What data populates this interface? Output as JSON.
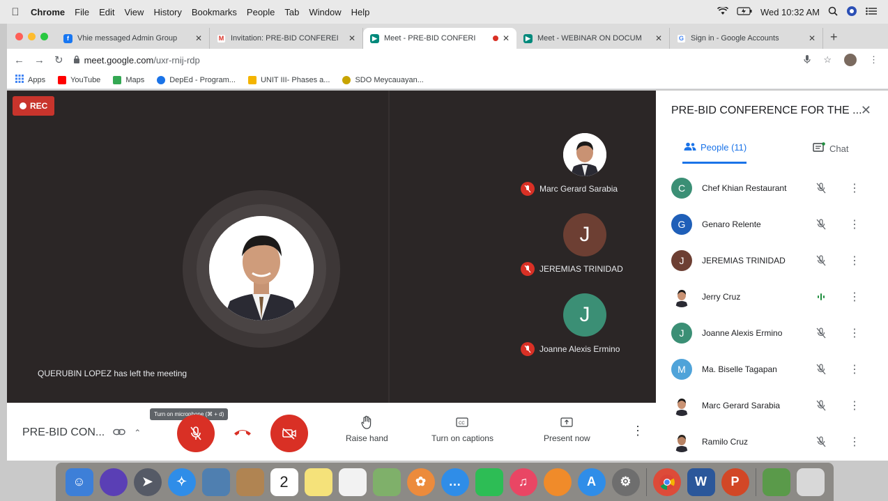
{
  "menubar": {
    "app": "Chrome",
    "items": [
      "File",
      "Edit",
      "View",
      "History",
      "Bookmarks",
      "People",
      "Tab",
      "Window",
      "Help"
    ],
    "clock": "Wed 10:32 AM"
  },
  "tabs": [
    {
      "title": "Vhie messaged Admin Group",
      "favicon_color": "#1877f2"
    },
    {
      "title": "Invitation: PRE-BID CONFEREI",
      "favicon_color": "#d93025"
    },
    {
      "title": "Meet - PRE-BID CONFERI",
      "favicon_color": "#00897b"
    },
    {
      "title": "Meet - WEBINAR ON DOCUM",
      "favicon_color": "#00897b"
    },
    {
      "title": "Sign in - Google Accounts",
      "favicon_color": "#4285f4"
    }
  ],
  "address": {
    "host": "meet.google.com",
    "path": "/uxr-rnij-rdp"
  },
  "bookmarks": [
    {
      "label": "Apps",
      "color": "#4285f4"
    },
    {
      "label": "YouTube",
      "color": "#ff0000"
    },
    {
      "label": "Maps",
      "color": "#34a853"
    },
    {
      "label": "DepEd - Program...",
      "color": "#1a73e8"
    },
    {
      "label": "UNIT III- Phases a...",
      "color": "#f4b400"
    },
    {
      "label": "SDO Meycauayan...",
      "color": "#c8a400"
    }
  ],
  "stage": {
    "rec_label": "REC",
    "toast": "QUERUBIN LOPEZ has left the meeting",
    "tiles": [
      {
        "name": "Marc Gerard Sarabia",
        "initial": "",
        "color": "#ffffff"
      },
      {
        "name": "JEREMIAS TRINIDAD",
        "initial": "J",
        "color": "#6d3f33"
      },
      {
        "name": "Joanne Alexis Ermino",
        "initial": "J",
        "color": "#3b8f75"
      }
    ]
  },
  "bottombar": {
    "meeting_title": "PRE-BID CON...",
    "mic_tooltip": "Turn on microphone (⌘ + d)",
    "raise_hand": "Raise hand",
    "captions": "Turn on captions",
    "present": "Present now"
  },
  "panel": {
    "title": "PRE-BID CONFERENCE FOR THE ...",
    "people_tab": "People (11)",
    "chat_tab": "Chat",
    "participants": [
      {
        "name": "Chef Khian Restaurant",
        "initial": "C",
        "color": "#3b8f75",
        "status": "muted"
      },
      {
        "name": "Genaro Relente",
        "initial": "G",
        "color": "#1f5fb8",
        "status": "muted"
      },
      {
        "name": "JEREMIAS TRINIDAD",
        "initial": "J",
        "color": "#6d3f33",
        "status": "muted"
      },
      {
        "name": "Jerry Cruz",
        "initial": "",
        "color": "#ffffff",
        "status": "speaking"
      },
      {
        "name": "Joanne Alexis Ermino",
        "initial": "J",
        "color": "#3b8f75",
        "status": "muted"
      },
      {
        "name": "Ma. Biselle Tagapan",
        "initial": "M",
        "color": "#4fa3d9",
        "status": "muted"
      },
      {
        "name": "Marc Gerard Sarabia",
        "initial": "",
        "color": "#ffffff",
        "status": "muted"
      },
      {
        "name": "Ramilo Cruz",
        "initial": "",
        "color": "#ffffff",
        "status": "muted"
      }
    ]
  },
  "dock": {
    "calendar_day": "2"
  }
}
